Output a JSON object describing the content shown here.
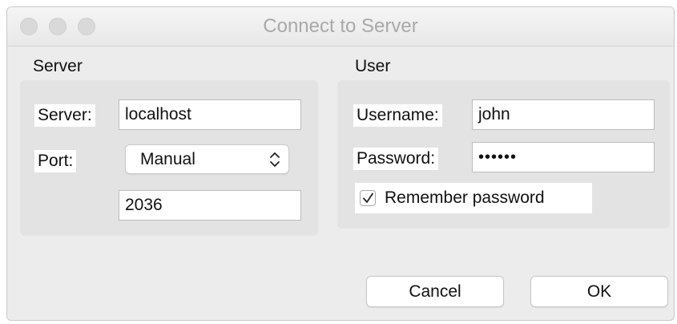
{
  "window": {
    "title": "Connect to Server"
  },
  "server_section": {
    "heading": "Server",
    "server_label": "Server:",
    "server_value": "localhost",
    "port_label": "Port:",
    "port_mode": "Manual",
    "port_value": "2036"
  },
  "user_section": {
    "heading": "User",
    "username_label": "Username:",
    "username_value": "john",
    "password_label": "Password:",
    "password_masked": "••••••",
    "remember_label": "Remember password",
    "remember_checked": true
  },
  "buttons": {
    "cancel_label": "Cancel",
    "ok_label": "OK"
  },
  "icons": {
    "close": "traffic-light-close-icon",
    "minimize": "traffic-light-minimize-icon",
    "zoom": "traffic-light-zoom-icon",
    "select_arrows": "chevron-updown-icon",
    "checkmark": "checkmark-icon"
  },
  "colors": {
    "window_bg": "#ececec",
    "group_bg": "#e3e3e3",
    "title_text": "#a9a9a9"
  }
}
